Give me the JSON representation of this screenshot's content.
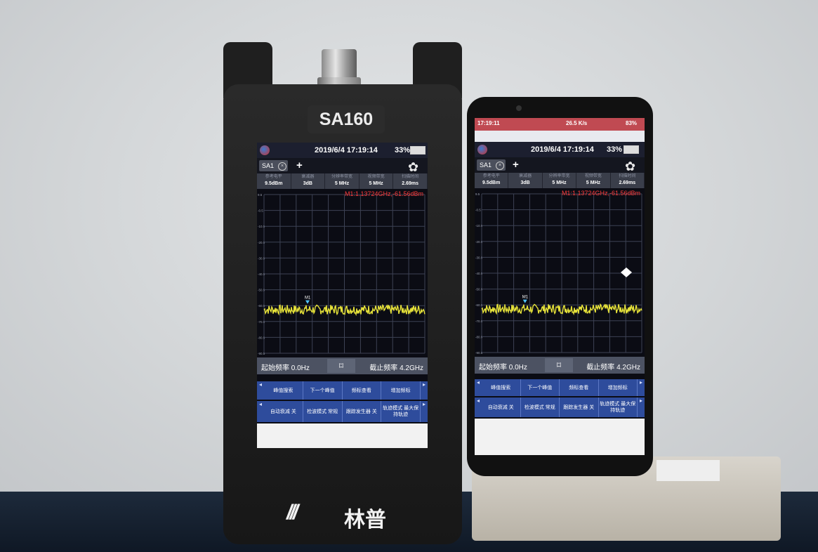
{
  "device": {
    "brand": "SA160",
    "logo_text": "林普"
  },
  "screen": {
    "datetime": "2019/6/4 17:19:14",
    "battery": "33%",
    "tab": "SA1",
    "params": [
      {
        "key": "参考电平",
        "value": "9.5dBm"
      },
      {
        "key": "衰减器",
        "value": "3dB"
      },
      {
        "key": "分辨率带宽",
        "value": "5 MHz"
      },
      {
        "key": "视频带宽",
        "value": "5 MHz"
      },
      {
        "key": "扫描时间",
        "value": "2.69ms"
      }
    ],
    "marker_readout": "M1:1.13724GHz,-61.56dBm",
    "marker_label": "M1",
    "y_ticks": [
      "9.5",
      "-0.5",
      "-10.5",
      "-20.5",
      "-30.5",
      "-40.5",
      "-50.5",
      "-60.5",
      "-70.5",
      "-80.5",
      "-90.5"
    ],
    "start_freq": "起始频率 0.0Hz",
    "stop_freq": "截止频率 4.2GHz",
    "softkeys_row1": [
      "峰值搜索",
      "下一个峰值",
      "频标查看",
      "增加频标"
    ],
    "softkeys_row2": [
      "自动衰减 关",
      "检波模式 常规",
      "跟踪发生器 关",
      "轨迹模式 最大保持轨迹"
    ]
  },
  "phone": {
    "status_time": "17:19:11",
    "status_right": "26.5 K/s",
    "status_battery": "83%",
    "datetime": "2019/6/4 17:19:14",
    "battery": "33%",
    "start_freq": "起始频率 0.0Hz",
    "stop_freq": "截止频率 4.2GHz"
  },
  "colors": {
    "trace": "#e6e23a",
    "marker": "#ff3b3b",
    "softkey_bg": "#2e4c9c",
    "grid": "#3d4254"
  }
}
